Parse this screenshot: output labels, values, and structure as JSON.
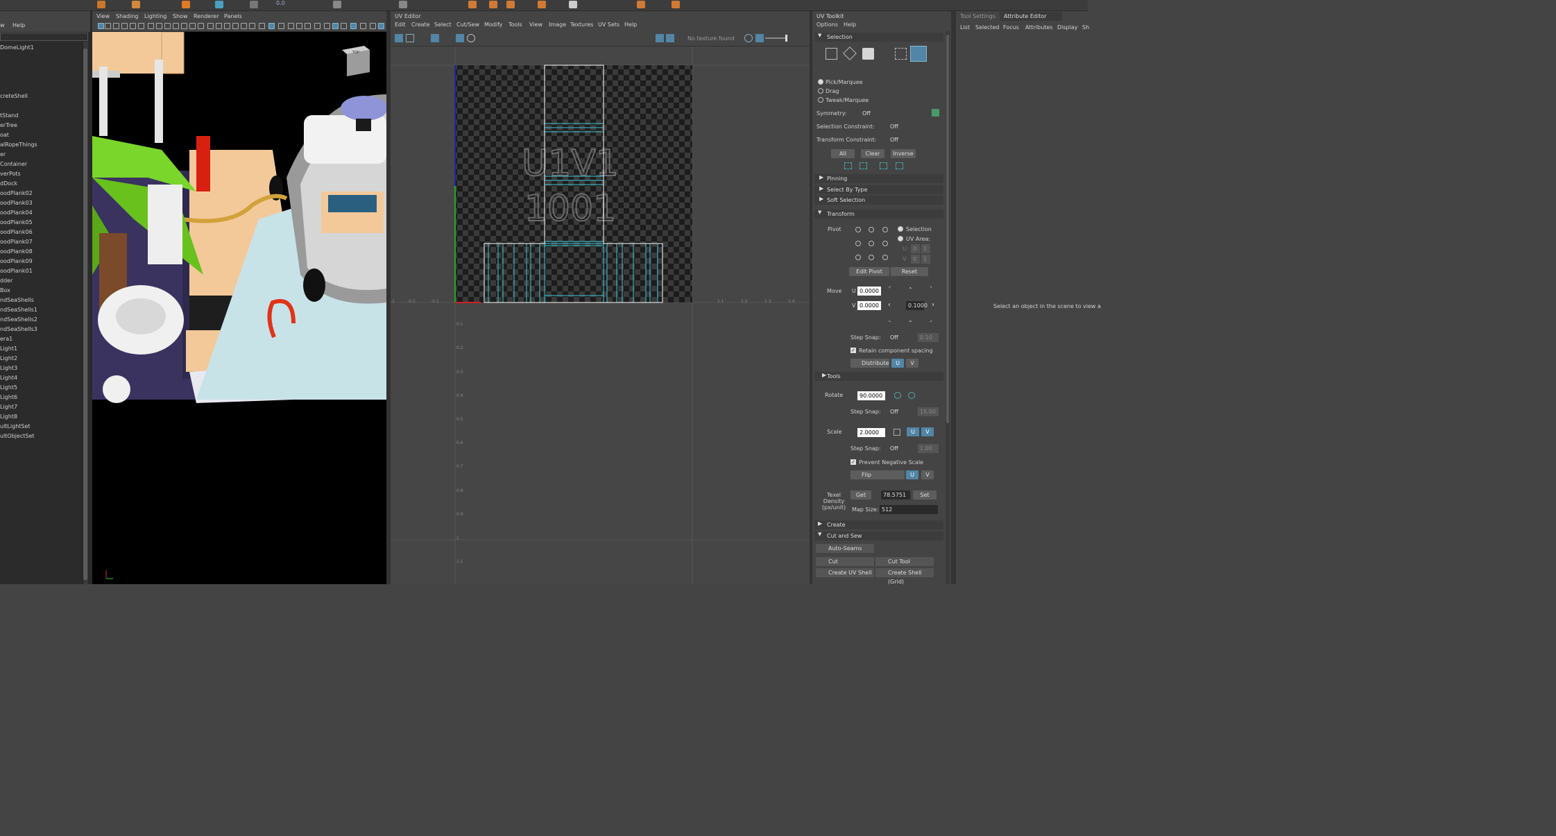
{
  "shelf": {
    "label": "0.0"
  },
  "outliner": {
    "menu": [
      "w",
      "Help"
    ],
    "items": [
      "DomeLight1",
      "",
      "",
      "",
      "",
      "creteShell",
      "",
      "tStand",
      "erTree",
      "oat",
      "alRopeThings",
      "er",
      "Container",
      "verPots",
      "dDock",
      "oodPlank02",
      "oodPlank03",
      "oodPlank04",
      "oodPlank05",
      "oodPlank06",
      "oodPlank07",
      "oodPlank08",
      "oodPlank09",
      "oodPlank01",
      "dder",
      "Box",
      "ndSeaShells",
      "ndSeaShells1",
      "ndSeaShells2",
      "ndSeaShells3",
      "era1",
      "Light1",
      "Light2",
      "Light3",
      "Light4",
      "Light5",
      "Light6",
      "Light7",
      "Light8",
      "ultLightSet",
      "ultObjectSet"
    ]
  },
  "viewport": {
    "menu": [
      "View",
      "Shading",
      "Lighting",
      "Show",
      "Renderer",
      "Panels"
    ],
    "cube_label": "TOP"
  },
  "uv": {
    "title": "UV Editor",
    "menu": [
      "Edit",
      "Create",
      "Select",
      "Cut/Sew",
      "Modify",
      "Tools",
      "View",
      "Image",
      "Textures",
      "UV Sets",
      "Help"
    ],
    "texture_status": "No texture found",
    "tile_line1": "U1V1",
    "tile_line2": "1001",
    "x_ticks": [
      "-0.2",
      "-0.1",
      "1.1",
      "1.2",
      "1.3",
      "1.4"
    ],
    "y_ticks": [
      "0.1",
      "0.2",
      "0.3",
      "0.4",
      "0.5",
      "0.6",
      "0.7",
      "0.8",
      "0.9",
      "1",
      "1.1"
    ],
    "corner_tick": "-1"
  },
  "toolkit": {
    "title": "UV Toolkit",
    "menu": [
      "Options",
      "Help"
    ],
    "selection": {
      "header": "Selection",
      "modes": [
        "Pick/Marquee",
        "Drag",
        "Tweak/Marquee"
      ],
      "symmetry_label": "Symmetry:",
      "symmetry_value": "Off",
      "sel_constraint_label": "Selection Constraint:",
      "sel_constraint_value": "Off",
      "trans_constraint_label": "Transform Constraint:",
      "trans_constraint_value": "Off",
      "btn_all": "All",
      "btn_clear": "Clear",
      "btn_inverse": "Inverse"
    },
    "pinning": "Pinning",
    "select_by_type": "Select By Type",
    "soft_selection": "Soft Selection",
    "transform": {
      "header": "Transform",
      "pivot_label": "Pivot",
      "pivot_opt1": "Selection",
      "pivot_opt2": "UV Area:",
      "pivot_u": "U:",
      "pivot_v": "V:",
      "pivot_u_val": "0",
      "pivot_v_val": "0",
      "pivot_u_val2": "1",
      "pivot_v_val2": "1",
      "edit_pivot": "Edit Pivot",
      "reset": "Reset",
      "move_label": "Move",
      "move_u_label": "U",
      "move_u": "0.0000",
      "move_v_label": "V",
      "move_v": "0.0000",
      "move_step": "0.1000",
      "step_snap_label": "Step Snap:",
      "step_snap_value": "Off",
      "step_snap_num": "0.10",
      "retain": "Retain component spacing",
      "distribute": "Distribute",
      "u": "U",
      "v": "V",
      "tools": "Tools",
      "rotate_label": "Rotate",
      "rotate_val": "90.0000",
      "rot_snap_num": "15.00",
      "scale_label": "Scale",
      "scale_val": "2.0000",
      "scale_snap_num": "1.00",
      "prevent_neg": "Prevent Negative Scale",
      "flip": "Flip",
      "texel_label": "Texel Density (px/unit)",
      "get": "Get",
      "texel_val": "78.5751",
      "set": "Set",
      "map_size_label": "Map Size:",
      "map_size_val": "512"
    },
    "create": "Create",
    "cut_sew": {
      "header": "Cut and Sew",
      "auto_seams": "Auto-Seams",
      "cut": "Cut",
      "cut_tool": "Cut Tool",
      "create_uv_shell": "Create UV Shell",
      "create_shell_grid": "Create Shell (Grid)"
    }
  },
  "attr": {
    "tabs": [
      "Tool Settings",
      "Attribute Editor"
    ],
    "menu": [
      "List",
      "Selected",
      "Focus",
      "Attributes",
      "Display",
      "Sh"
    ],
    "empty_msg": "Select an object in the scene to view a"
  },
  "colors": {
    "accent": "#5285a6",
    "uv_shell": "#3fc7d6",
    "tile_border": "#ffffff"
  }
}
